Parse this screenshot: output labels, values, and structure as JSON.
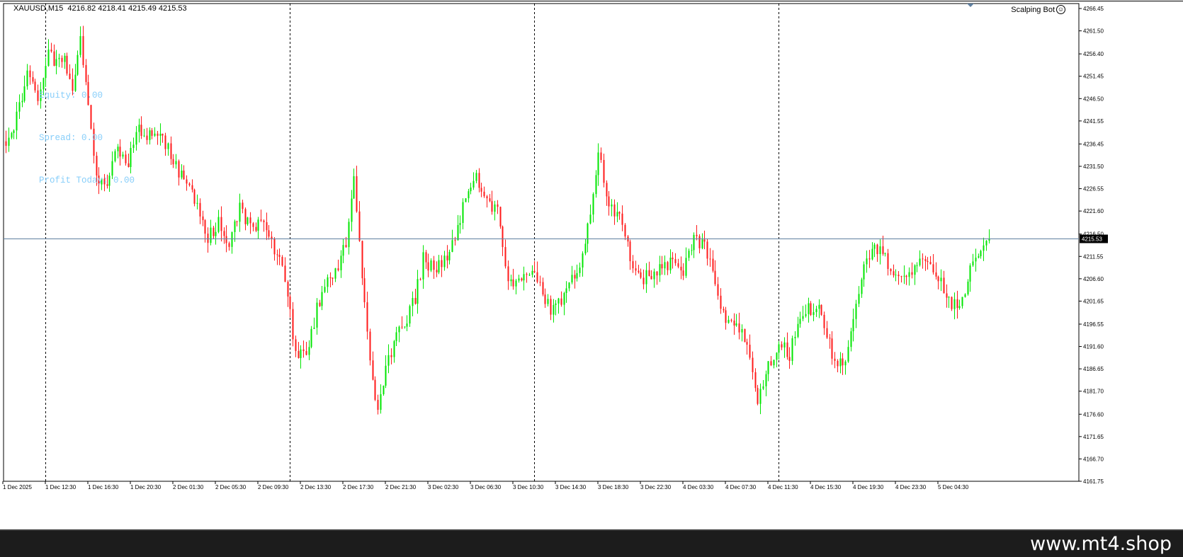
{
  "header": {
    "symbol_label": "XAUUSD,M15",
    "ohlc": "4216.82 4218.41 4215.49 4215.53"
  },
  "expert": {
    "name": "Scalping Bot",
    "icon": "smiley-icon"
  },
  "info_panel": {
    "lines": [
      "Equity: 0.00",
      "Spread: 0.00",
      "Profit Today: 0.00"
    ]
  },
  "watermark": "www.mt4.shop",
  "colors": {
    "bull": "#00e600",
    "bear": "#ff1a1a",
    "grid": "#000000",
    "bid_line": "#5f7f9f",
    "price_label_bg": "#000000",
    "price_label_fg": "#ffffff",
    "info_text": "#87cefa"
  },
  "chart_data": {
    "type": "candlestick",
    "symbol": "XAUUSD",
    "timeframe": "M15",
    "ylim": [
      4161.75,
      4267.55
    ],
    "y_ticks": [
      4266.45,
      4261.5,
      4256.4,
      4251.45,
      4246.5,
      4241.55,
      4236.45,
      4231.5,
      4226.55,
      4221.6,
      4216.5,
      4211.55,
      4206.6,
      4201.65,
      4196.55,
      4191.6,
      4186.65,
      4181.7,
      4176.6,
      4171.65,
      4166.7,
      4161.75
    ],
    "x_ticks": [
      "1 Dec 2025",
      "1 Dec 12:30",
      "1 Dec 16:30",
      "1 Dec 20:30",
      "2 Dec 01:30",
      "2 Dec 05:30",
      "2 Dec 09:30",
      "2 Dec 13:30",
      "2 Dec 17:30",
      "2 Dec 21:30",
      "3 Dec 02:30",
      "3 Dec 06:30",
      "3 Dec 10:30",
      "3 Dec 14:30",
      "3 Dec 18:30",
      "3 Dec 22:30",
      "4 Dec 03:30",
      "4 Dec 07:30",
      "4 Dec 11:30",
      "4 Dec 15:30",
      "4 Dec 19:30",
      "4 Dec 23:30",
      "5 Dec 04:30"
    ],
    "period_separators": [
      "2 Dec 2025",
      "3 Dec 2025",
      "4 Dec 2025",
      "5 Dec 2025"
    ],
    "current_price": "4215.53",
    "grid": false,
    "bars_per_tick": 16,
    "close_anchors": [
      [
        0,
        4235
      ],
      [
        4,
        4243
      ],
      [
        8,
        4252
      ],
      [
        12,
        4247
      ],
      [
        16,
        4257
      ],
      [
        19,
        4254
      ],
      [
        22,
        4256
      ],
      [
        25,
        4248
      ],
      [
        28,
        4259
      ],
      [
        31,
        4244
      ],
      [
        34,
        4229
      ],
      [
        38,
        4228
      ],
      [
        42,
        4236
      ],
      [
        46,
        4232
      ],
      [
        50,
        4240
      ],
      [
        54,
        4238
      ],
      [
        58,
        4238
      ],
      [
        62,
        4234
      ],
      [
        66,
        4229
      ],
      [
        70,
        4226
      ],
      [
        73,
        4221
      ],
      [
        76,
        4216
      ],
      [
        80,
        4219
      ],
      [
        84,
        4214
      ],
      [
        88,
        4222
      ],
      [
        92,
        4218
      ],
      [
        96,
        4219
      ],
      [
        100,
        4214
      ],
      [
        103,
        4212
      ],
      [
        106,
        4204
      ],
      [
        109,
        4190
      ],
      [
        113,
        4189
      ],
      [
        117,
        4200
      ],
      [
        120,
        4205
      ],
      [
        124,
        4208
      ],
      [
        128,
        4215
      ],
      [
        131,
        4228
      ],
      [
        134,
        4207
      ],
      [
        137,
        4188
      ],
      [
        140,
        4177
      ],
      [
        143,
        4186
      ],
      [
        146,
        4193
      ],
      [
        150,
        4197
      ],
      [
        154,
        4202
      ],
      [
        157,
        4211
      ],
      [
        161,
        4209
      ],
      [
        165,
        4211
      ],
      [
        169,
        4215
      ],
      [
        173,
        4225
      ],
      [
        177,
        4229
      ],
      [
        181,
        4224
      ],
      [
        185,
        4221
      ],
      [
        189,
        4207
      ],
      [
        193,
        4206
      ],
      [
        197,
        4208
      ],
      [
        201,
        4206
      ],
      [
        205,
        4199
      ],
      [
        209,
        4202
      ],
      [
        213,
        4206
      ],
      [
        217,
        4212
      ],
      [
        220,
        4222
      ],
      [
        223,
        4235
      ],
      [
        227,
        4222
      ],
      [
        231,
        4220
      ],
      [
        235,
        4211
      ],
      [
        239,
        4206
      ],
      [
        243,
        4208
      ],
      [
        247,
        4209
      ],
      [
        251,
        4210
      ],
      [
        255,
        4208
      ],
      [
        259,
        4215
      ],
      [
        263,
        4214
      ],
      [
        267,
        4205
      ],
      [
        271,
        4196
      ],
      [
        275,
        4197
      ],
      [
        279,
        4192
      ],
      [
        283,
        4180
      ],
      [
        287,
        4187
      ],
      [
        291,
        4192
      ],
      [
        295,
        4190
      ],
      [
        299,
        4199
      ],
      [
        303,
        4200
      ],
      [
        307,
        4199
      ],
      [
        311,
        4190
      ],
      [
        315,
        4187
      ],
      [
        319,
        4198
      ],
      [
        323,
        4211
      ],
      [
        327,
        4214
      ],
      [
        331,
        4211
      ],
      [
        335,
        4208
      ],
      [
        339,
        4207
      ],
      [
        343,
        4209
      ],
      [
        347,
        4211
      ],
      [
        351,
        4207
      ],
      [
        355,
        4201
      ],
      [
        359,
        4201
      ],
      [
        363,
        4208
      ],
      [
        367,
        4214
      ],
      [
        370,
        4216
      ]
    ]
  }
}
